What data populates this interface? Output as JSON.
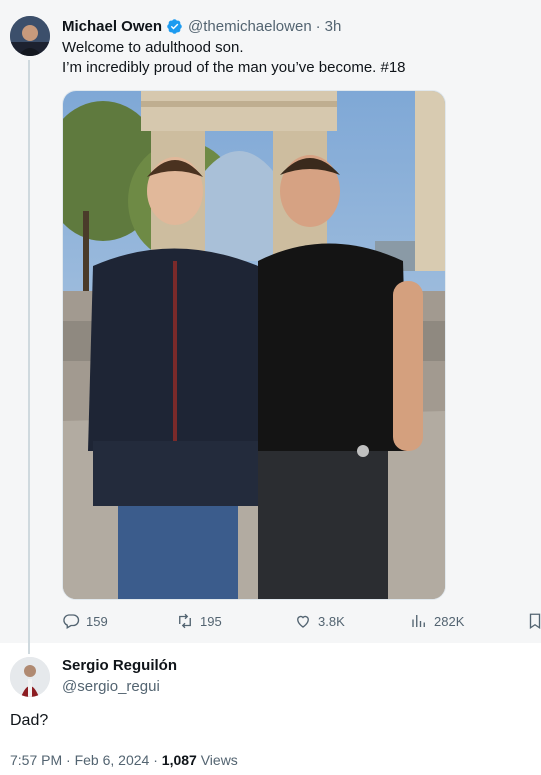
{
  "quoted_tweet": {
    "author_name": "Michael Owen",
    "handle": "@themichaelowen",
    "separator": "·",
    "time": "3h",
    "text_line1": "Welcome to adulthood son.",
    "text_line2": "I’m incredibly proud of the man you’ve become. #18",
    "actions": {
      "replies": "159",
      "retweets": "195",
      "likes": "3.8K",
      "views": "282K"
    }
  },
  "reply_tweet": {
    "author_name": "Sergio Reguilón",
    "handle": "@sergio_regui",
    "text": "Dad?",
    "time": "7:57 PM",
    "date": "Feb 6, 2024",
    "dot": "·",
    "views_count": "1,087",
    "views_label": "Views"
  },
  "icons": {
    "verified": "verified-badge-icon",
    "reply": "reply-icon",
    "retweet": "retweet-icon",
    "like": "heart-icon",
    "views": "views-chart-icon",
    "bookmark": "bookmark-icon"
  },
  "colors": {
    "verified_blue": "#1d9bf0",
    "secondary_text": "#536471",
    "primary_text": "#0f1419"
  }
}
